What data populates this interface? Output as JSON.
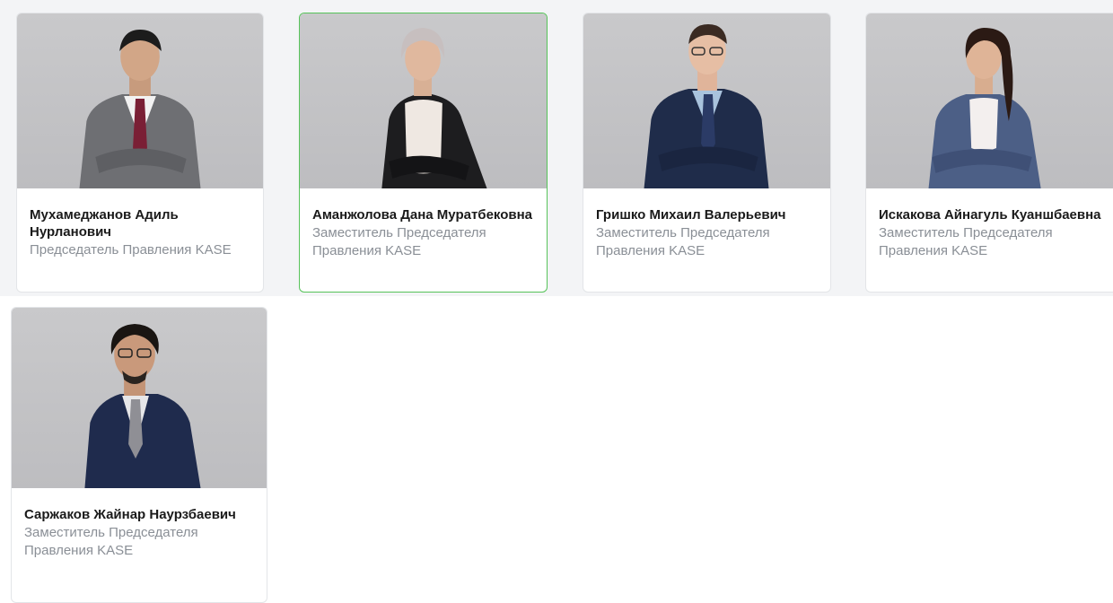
{
  "people": [
    {
      "name": "Мухамеджанов Адиль Нурланович",
      "role": "Председатель Правления KASE"
    },
    {
      "name": "Аманжолова Дана Муратбековна",
      "role": "Заместитель Председателя Правления KASE"
    },
    {
      "name": "Гришко Михаил Валерьевич",
      "role": "Заместитель Председателя Правления KASE"
    },
    {
      "name": "Искакова Айнагуль Куаншбаевна",
      "role": "Заместитель Председателя Правления KASE"
    },
    {
      "name": "Саржаков Жайнар Наурзбаевич",
      "role": "Заместитель Председателя Правления KASE"
    }
  ],
  "colors": {
    "accent_border": "#57c35a",
    "name_text": "#1a1a1a",
    "role_text": "#8a8f96",
    "band_background": "#f3f4f6"
  }
}
